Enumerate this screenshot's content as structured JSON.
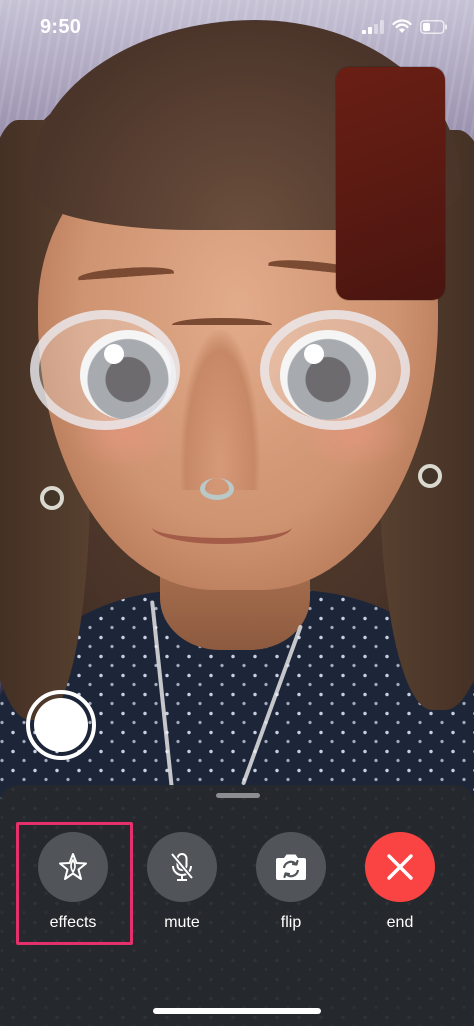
{
  "status_bar": {
    "time": "9:50",
    "icons": [
      "cellular-signal-icon",
      "wifi-icon",
      "battery-icon"
    ]
  },
  "call": {
    "capture_icon": "capture-shutter-icon",
    "controls": [
      {
        "id": "effects",
        "label": "effects",
        "icon": "effects-star-icon",
        "highlighted": true
      },
      {
        "id": "mute",
        "label": "mute",
        "icon": "microphone-slash-icon",
        "highlighted": false
      },
      {
        "id": "flip",
        "label": "flip",
        "icon": "camera-flip-icon",
        "highlighted": false
      },
      {
        "id": "end",
        "label": "end",
        "icon": "close-x-icon",
        "highlighted": false
      }
    ]
  },
  "colors": {
    "end_button": "#fa4444",
    "highlight_border": "#e5306b",
    "control_circle": "#515459",
    "panel": "#26282c"
  }
}
